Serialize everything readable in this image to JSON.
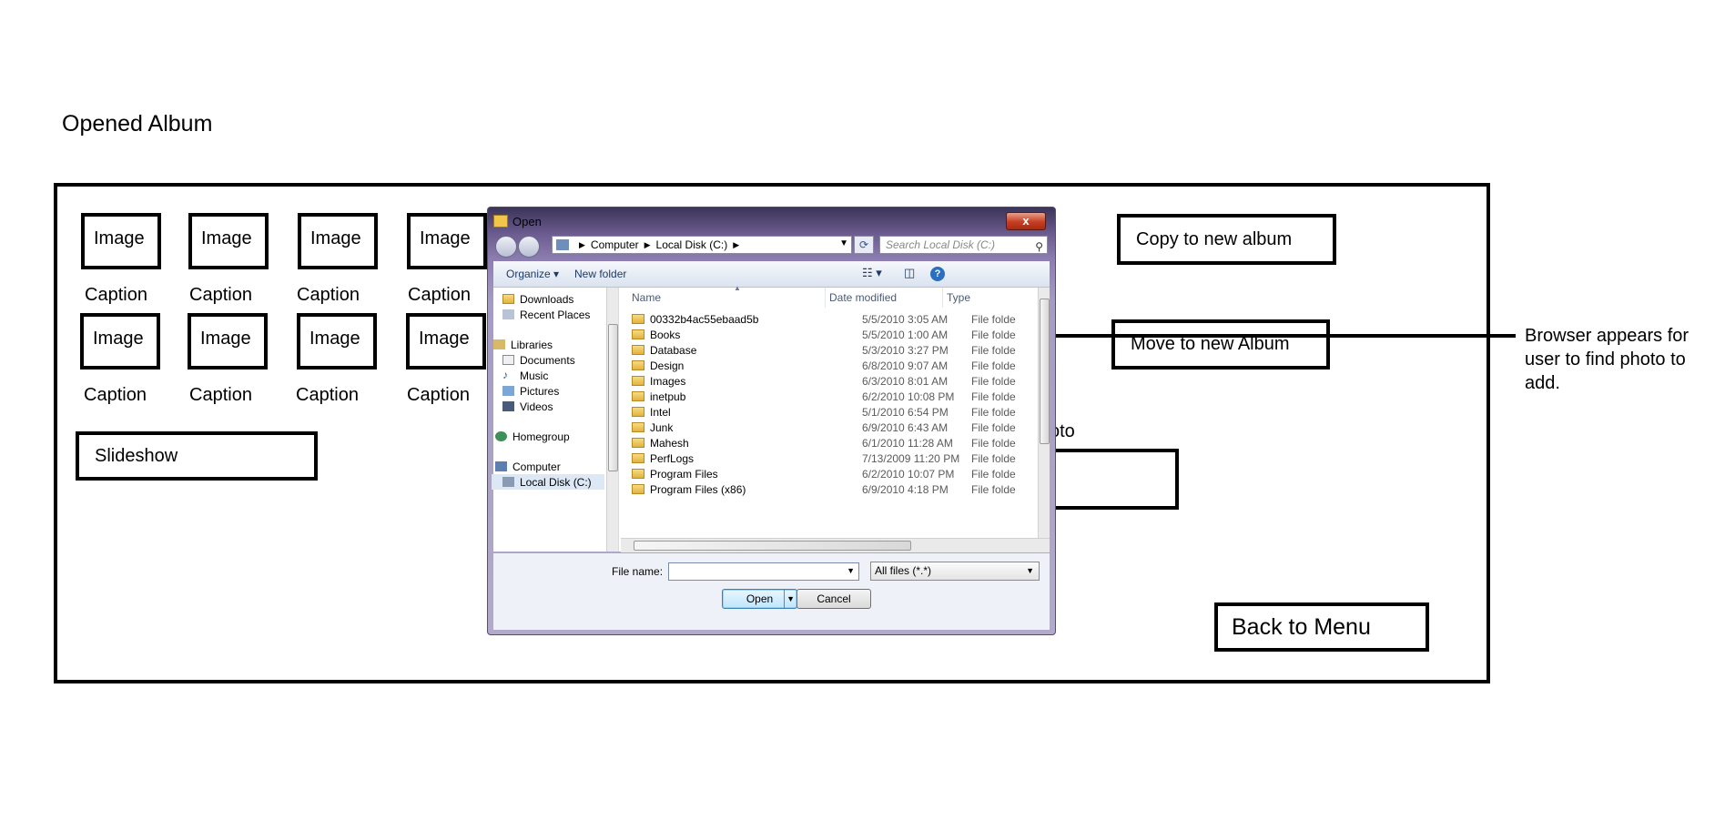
{
  "page_title": "Opened Album",
  "album": {
    "image_label": "Image",
    "caption_label": "Caption",
    "slideshow_label": "Slideshow",
    "copy_label": "Copy to new album",
    "move_label": "Move to new Album",
    "add_photo_partial": "oto",
    "back_label": "Back to Menu"
  },
  "annotation": "Browser appears for user to find photo to add.",
  "dialog": {
    "title": "Open",
    "close_label": "x",
    "breadcrumb": [
      "Computer",
      "Local Disk (C:)"
    ],
    "search_placeholder": "Search Local Disk (C:)",
    "organize_label": "Organize ▾",
    "new_folder_label": "New folder",
    "help_label": "?",
    "nav": {
      "favorites": [
        "Downloads",
        "Recent Places"
      ],
      "libraries_label": "Libraries",
      "libraries": [
        "Documents",
        "Music",
        "Pictures",
        "Videos"
      ],
      "homegroup_label": "Homegroup",
      "computer_label": "Computer",
      "local_disk_label": "Local Disk (C:)"
    },
    "columns": {
      "name": "Name",
      "date": "Date modified",
      "type": "Type"
    },
    "files": [
      {
        "name": "00332b4ac55ebaad5b",
        "date": "5/5/2010 3:05 AM",
        "type": "File folde"
      },
      {
        "name": "Books",
        "date": "5/5/2010 1:00 AM",
        "type": "File folde"
      },
      {
        "name": "Database",
        "date": "5/3/2010 3:27 PM",
        "type": "File folde"
      },
      {
        "name": "Design",
        "date": "6/8/2010 9:07 AM",
        "type": "File folde"
      },
      {
        "name": "Images",
        "date": "6/3/2010 8:01 AM",
        "type": "File folde"
      },
      {
        "name": "inetpub",
        "date": "6/2/2010 10:08 PM",
        "type": "File folde"
      },
      {
        "name": "Intel",
        "date": "5/1/2010 6:54 PM",
        "type": "File folde"
      },
      {
        "name": "Junk",
        "date": "6/9/2010 6:43 AM",
        "type": "File folde"
      },
      {
        "name": "Mahesh",
        "date": "6/1/2010 11:28 AM",
        "type": "File folde"
      },
      {
        "name": "PerfLogs",
        "date": "7/13/2009 11:20 PM",
        "type": "File folde"
      },
      {
        "name": "Program Files",
        "date": "6/2/2010 10:07 PM",
        "type": "File folde"
      },
      {
        "name": "Program Files (x86)",
        "date": "6/9/2010 4:18 PM",
        "type": "File folde"
      }
    ],
    "filename_label": "File name:",
    "filename_value": "",
    "filter_value": "All files (*.*)",
    "open_label": "Open",
    "cancel_label": "Cancel"
  }
}
